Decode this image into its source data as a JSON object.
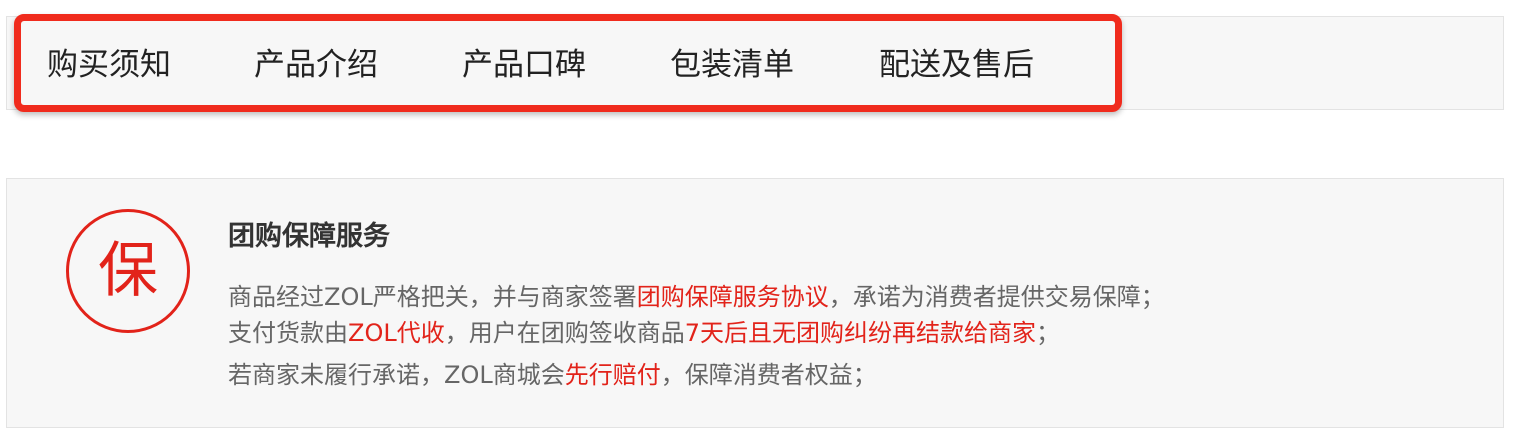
{
  "colors": {
    "highlight_border": "#f02b1d",
    "accent_red": "#e2231a",
    "panel_bg": "#f7f7f7",
    "body_text": "#666666",
    "title_text": "#333333"
  },
  "tabs": [
    {
      "label": "购买须知"
    },
    {
      "label": "产品介绍"
    },
    {
      "label": "产品口碑"
    },
    {
      "label": "包装清单"
    },
    {
      "label": "配送及售后"
    }
  ],
  "guarantee": {
    "icon": "bao-seal-icon",
    "badge_char": "保",
    "title": "团购保障服务",
    "line1": {
      "part1": "商品经过ZOL严格把关，并与商家签署",
      "highlight1": "团购保障服务协议",
      "part2": "，承诺为消费者提供交易保障；"
    },
    "line2": {
      "part1": "支付货款由",
      "highlight1": "ZOL代收",
      "part2": "，用户在团购签收商品",
      "highlight2": "7天后且无团购纠纷再结款给商家",
      "part3": "；"
    },
    "line3": {
      "part1": "若商家未履行承诺，ZOL商城会",
      "highlight1": "先行赔付",
      "part2": "，保障消费者权益；"
    }
  }
}
